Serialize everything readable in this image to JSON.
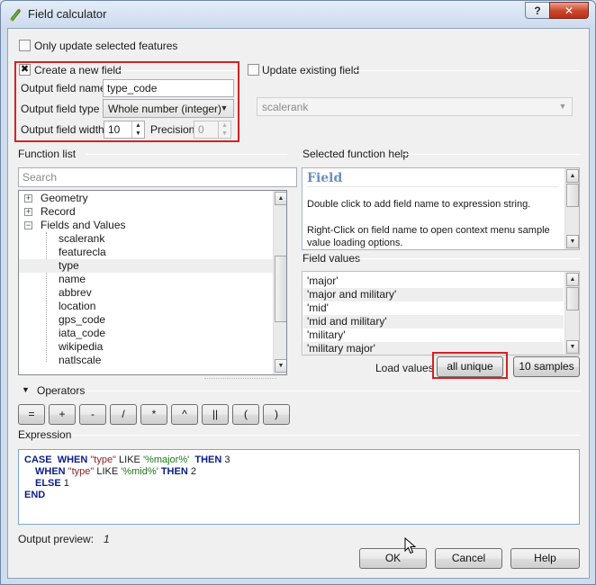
{
  "window": {
    "title": "Field calculator",
    "help_glyph": "?",
    "close_glyph": "✕"
  },
  "only_selected": {
    "label": "Only update selected features",
    "checked": false
  },
  "create_field": {
    "label": "Create a new field",
    "checked": true,
    "check_glyph": "✖",
    "name_label": "Output field name",
    "name_value": "type_code",
    "type_label": "Output field type",
    "type_value": "Whole number (integer)",
    "width_label": "Output field width",
    "width_value": "10",
    "precision_label": "Precision",
    "precision_value": "0"
  },
  "update_field": {
    "label": "Update existing field",
    "checked": false,
    "combo_value": "scalerank"
  },
  "function_list": {
    "title": "Function list",
    "search_placeholder": "Search",
    "groups": [
      {
        "label": "Geometry",
        "expander": "+"
      },
      {
        "label": "Record",
        "expander": "+"
      },
      {
        "label": "Fields and Values",
        "expander": "−"
      }
    ],
    "fields": [
      "scalerank",
      "featurecla",
      "type",
      "name",
      "abbrev",
      "location",
      "gps_code",
      "iata_code",
      "wikipedia",
      "natlscale"
    ],
    "selected_field": "type"
  },
  "help_panel": {
    "title": "Selected function help",
    "heading": "Field",
    "line1": "Double click to add field name to expression string.",
    "line2": "Right-Click on field name to open context menu sample value loading options."
  },
  "field_values": {
    "title": "Field values",
    "values": [
      "'major'",
      "'major and military'",
      "'mid'",
      "'mid and military'",
      "'military'",
      "'military major'"
    ],
    "load_label": "Load values",
    "all_unique_label": "all unique",
    "samples_label": "10 samples"
  },
  "operators": {
    "title": "Operators",
    "toggle_glyph": "▼",
    "buttons": [
      "=",
      "+",
      "-",
      "/",
      "*",
      "^",
      "||",
      "(",
      ")"
    ]
  },
  "expression": {
    "title": "Expression",
    "tokens": {
      "case": "CASE",
      "when": "WHEN",
      "field": "\"type\"",
      "like": "LIKE",
      "pat1": "'%major%'",
      "then": "THEN",
      "val1": "3",
      "pat2": "'%mid%'",
      "val2": "2",
      "else": "ELSE",
      "val3": "1",
      "end": "END"
    }
  },
  "output_preview": {
    "label": "Output preview:",
    "value": "1"
  },
  "dialog_buttons": {
    "ok": "OK",
    "cancel": "Cancel",
    "help": "Help"
  },
  "colors": {
    "highlight": "#d42222",
    "keyword": "#0b1d86",
    "string": "#1a7a12",
    "help_heading": "#6a8fc0"
  }
}
